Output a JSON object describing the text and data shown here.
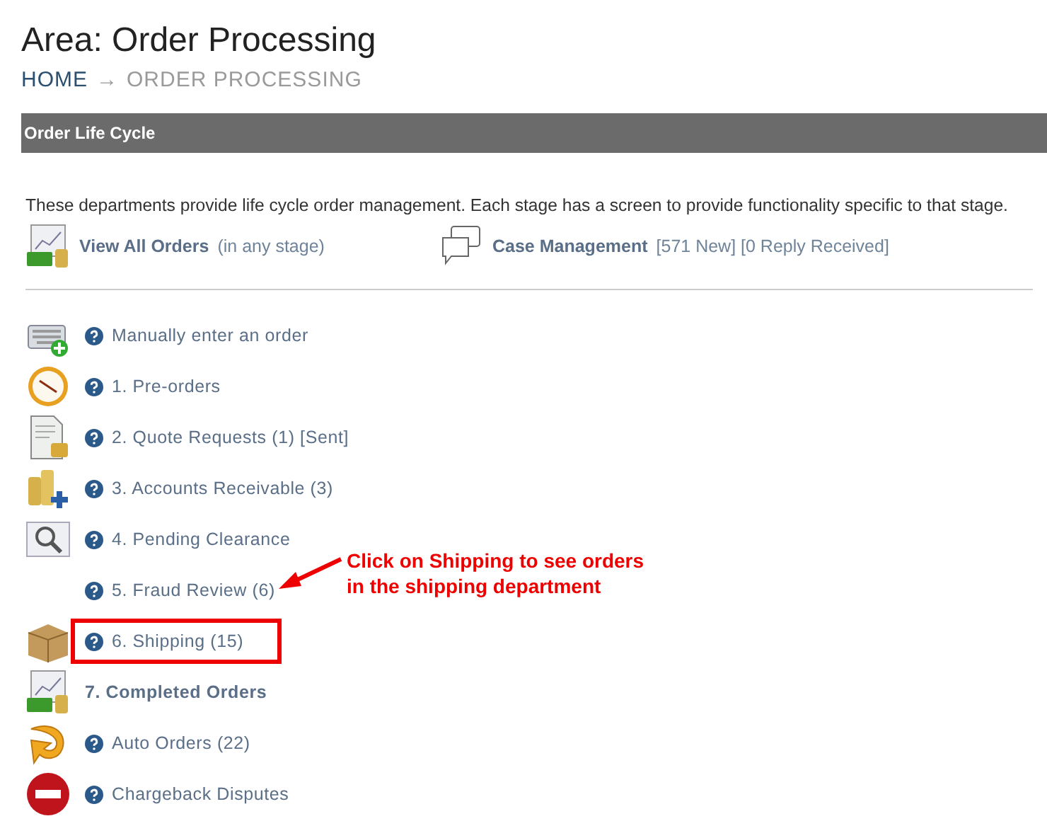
{
  "page_title": "Area: Order Processing",
  "breadcrumb": [
    {
      "label": "HOME",
      "link": true
    },
    {
      "label": "→",
      "link": false
    },
    {
      "label": "ORDER PROCESSING",
      "link": false
    }
  ],
  "section": {
    "title": "Order Life Cycle"
  },
  "description": "These departments provide life cycle order management. Each stage has a screen to provide functionality specific to that stage.",
  "quick_links": [
    {
      "kind": "chart",
      "label": "View All Orders",
      "note": "(in any stage)"
    },
    {
      "kind": "chat",
      "label": "Case Management",
      "note": "[571 New] [0 Reply Received]"
    }
  ],
  "stages": [
    {
      "kind": "keyboard",
      "help": true,
      "label": "Manually enter an order",
      "bold": false,
      "highlighted": false
    },
    {
      "kind": "clock",
      "help": true,
      "label": "1. Pre-orders",
      "bold": false,
      "highlighted": false
    },
    {
      "kind": "document",
      "help": true,
      "label": "2. Quote Requests (1) [Sent]",
      "bold": false,
      "highlighted": false
    },
    {
      "kind": "coins",
      "help": true,
      "label": "3. Accounts Receivable (3)",
      "bold": false,
      "highlighted": false
    },
    {
      "kind": "magnifier",
      "help": true,
      "label": "4. Pending Clearance",
      "bold": false,
      "highlighted": false
    },
    {
      "kind": "plain",
      "help": true,
      "label": "5. Fraud Review (6)",
      "bold": false,
      "highlighted": false
    },
    {
      "kind": "box",
      "help": true,
      "label": "6. Shipping (15)",
      "bold": false,
      "highlighted": true
    },
    {
      "kind": "chart",
      "help": false,
      "label": "7. Completed Orders",
      "bold": true,
      "highlighted": false
    },
    {
      "kind": "arrow",
      "help": true,
      "label": "Auto Orders (22)",
      "bold": false,
      "highlighted": false
    },
    {
      "kind": "stop",
      "help": true,
      "label": "Chargeback Disputes",
      "bold": false,
      "highlighted": false
    }
  ],
  "annotation": {
    "lines": [
      "Click on Shipping to see orders",
      "in the shipping department"
    ]
  }
}
